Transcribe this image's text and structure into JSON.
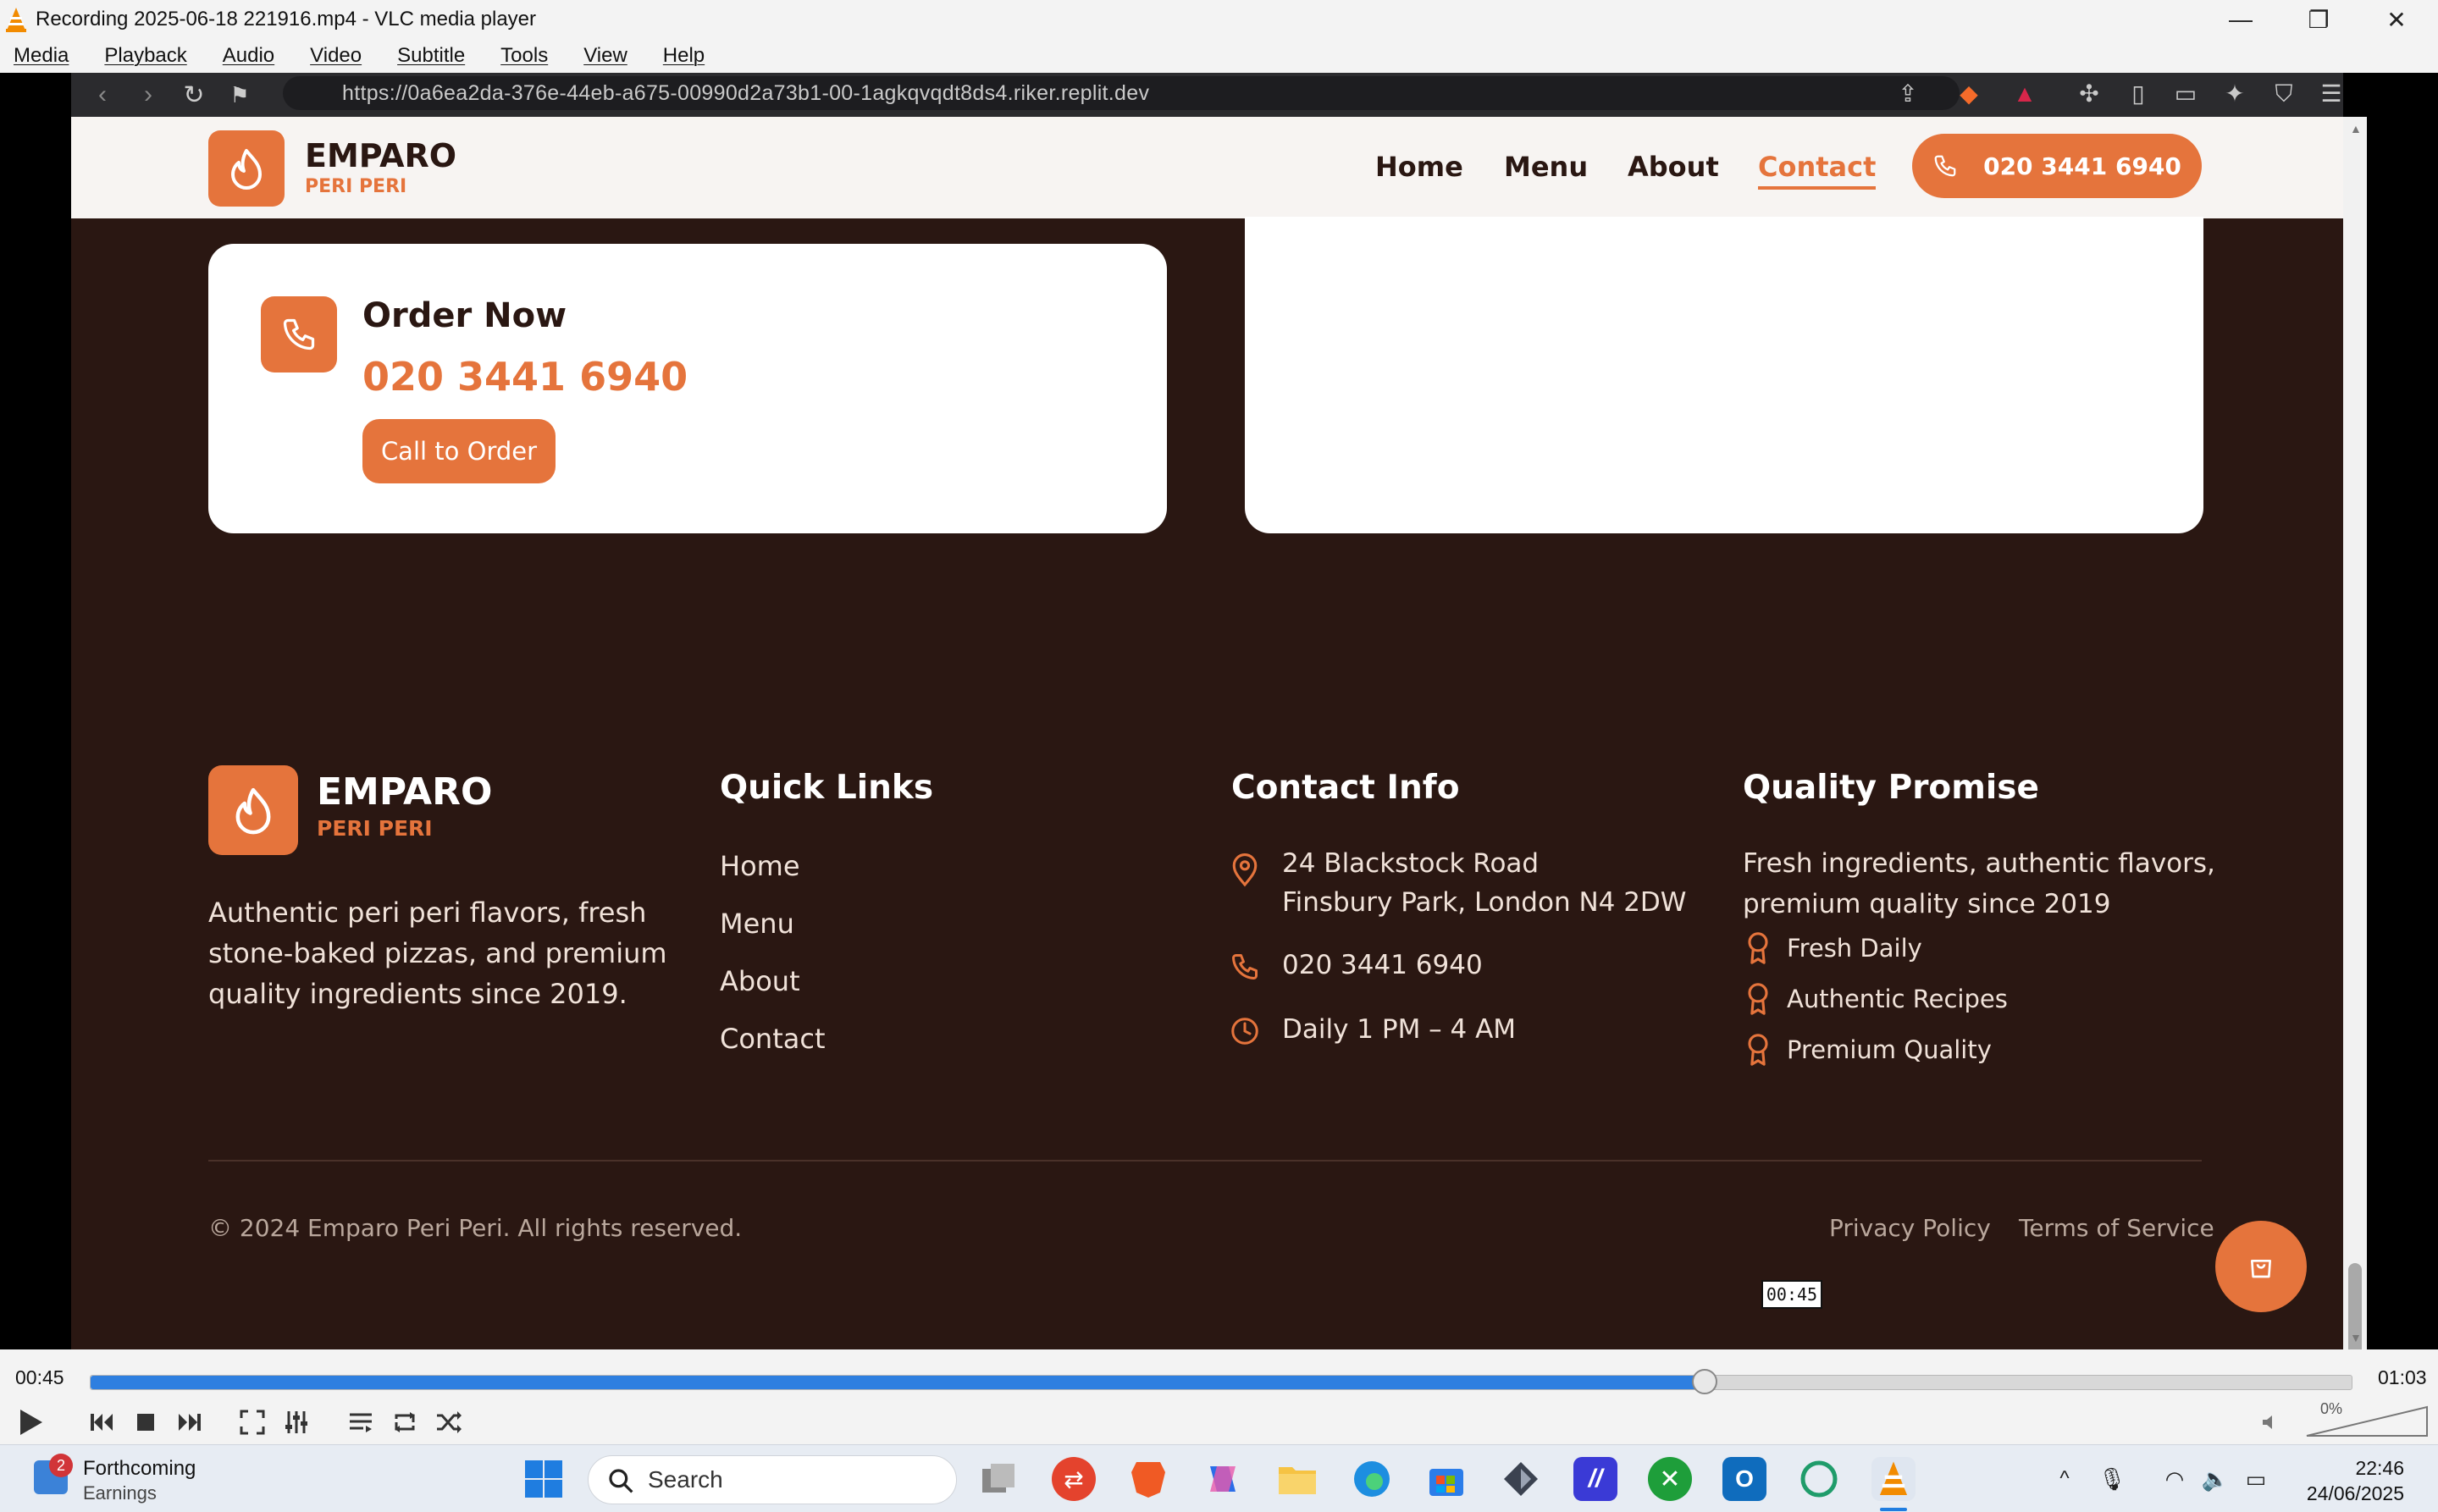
{
  "window": {
    "title": "Recording 2025-06-18 221916.mp4 - VLC media player",
    "menu": [
      "Media",
      "Playback",
      "Audio",
      "Video",
      "Subtitle",
      "Tools",
      "View",
      "Help"
    ]
  },
  "browser": {
    "url": "https://0a6ea2da-376e-44eb-a675-00990d2a73b1-00-1agkqvqdt8ds4.riker.replit.dev"
  },
  "site": {
    "brand": "EMPARO",
    "brand_sub": "PERI PERI",
    "nav": [
      "Home",
      "Menu",
      "About",
      "Contact"
    ],
    "nav_active": "Contact",
    "header_phone": "020 3441 6940",
    "order_card": {
      "heading": "Order Now",
      "phone": "020 3441 6940",
      "button": "Call to Order"
    },
    "footer": {
      "brand": "EMPARO",
      "brand_sub": "PERI PERI",
      "about": "Authentic peri peri flavors, fresh stone-baked pizzas, and premium quality ingredients since 2019.",
      "quick_links_title": "Quick Links",
      "quick_links": [
        "Home",
        "Menu",
        "About",
        "Contact"
      ],
      "contact_title": "Contact Info",
      "address_line1": "24 Blackstock Road",
      "address_line2": "Finsbury Park, London N4 2DW",
      "phone": "020 3441 6940",
      "hours": "Daily 1 PM – 4 AM",
      "quality_title": "Quality Promise",
      "quality_text": "Fresh ingredients, authentic flavors, premium quality since 2019",
      "quality_items": [
        "Fresh Daily",
        "Authentic Recipes",
        "Premium Quality"
      ],
      "copyright": "© 2024 Emparo Peri Peri. All rights reserved.",
      "privacy": "Privacy Policy",
      "terms": "Terms of Service"
    }
  },
  "player": {
    "elapsed": "00:45",
    "total": "01:03",
    "tooltip": "00:45",
    "progress_fraction": 0.714,
    "volume": "0%"
  },
  "taskbar": {
    "weather_badge": "2",
    "weather_title": "Forthcoming",
    "weather_sub": "Earnings",
    "search_placeholder": "Search",
    "time": "22:46",
    "date": "24/06/2025"
  },
  "colors": {
    "accent": "#e5743c",
    "footer_bg": "#2a1712",
    "seek_fill": "#2e7fe0"
  }
}
